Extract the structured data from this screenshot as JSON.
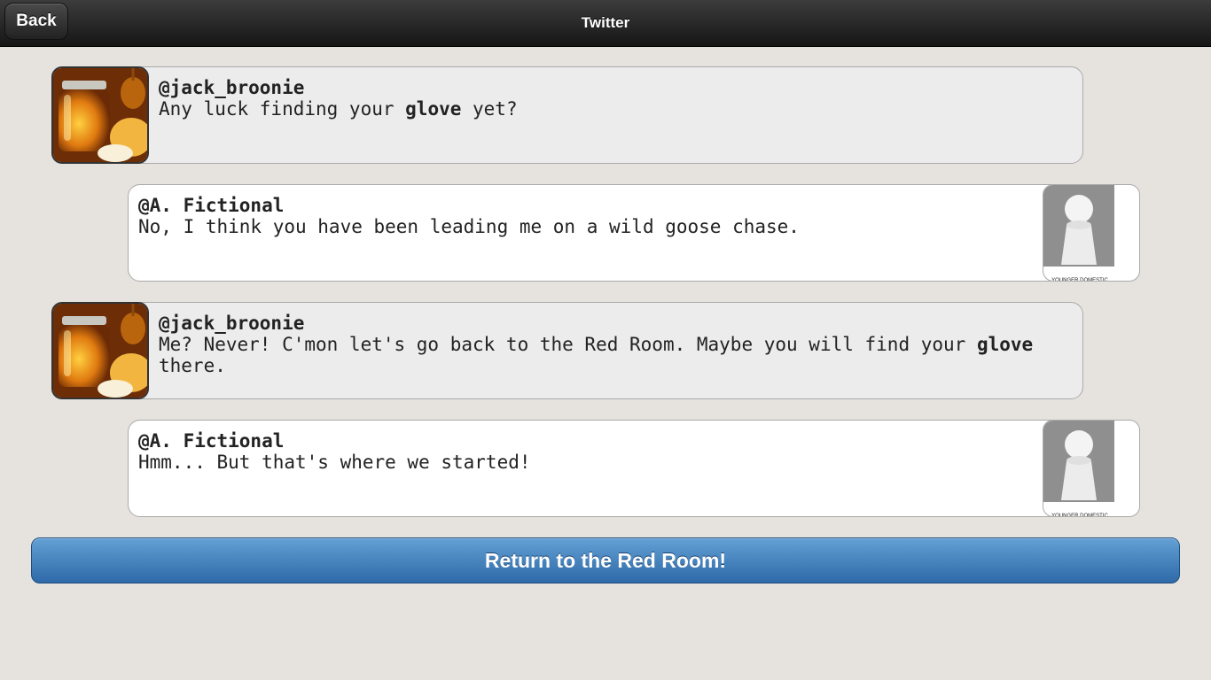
{
  "header": {
    "back_label": "Back",
    "title": "Twitter"
  },
  "tweets": [
    {
      "author": "@jack_broonie",
      "parts": [
        "Any luck finding your ",
        "glove",
        " yet?"
      ],
      "avatar": "honey-jar-avatar"
    },
    {
      "author": "@A. Fictional",
      "parts": [
        "No, I think you have been leading me on a wild goose chase."
      ],
      "avatar": "pawn-avatar",
      "avatar_caption": "YOUNGER DOMESTIC EXPLORER"
    },
    {
      "author": "@jack_broonie",
      "parts": [
        "Me? Never! C'mon let's go back to the Red Room. Maybe you will find your ",
        "glove",
        " there."
      ],
      "avatar": "honey-jar-avatar"
    },
    {
      "author": "@A. Fictional",
      "parts": [
        "Hmm... But that's where we started!"
      ],
      "avatar": "pawn-avatar",
      "avatar_caption": "YOUNGER DOMESTIC EXPLORER"
    }
  ],
  "return_button": {
    "label": "Return to the Red Room!"
  },
  "colors": {
    "background": "#e6e3de",
    "header": "#1e1e1e",
    "button": "#3f7fbf"
  }
}
